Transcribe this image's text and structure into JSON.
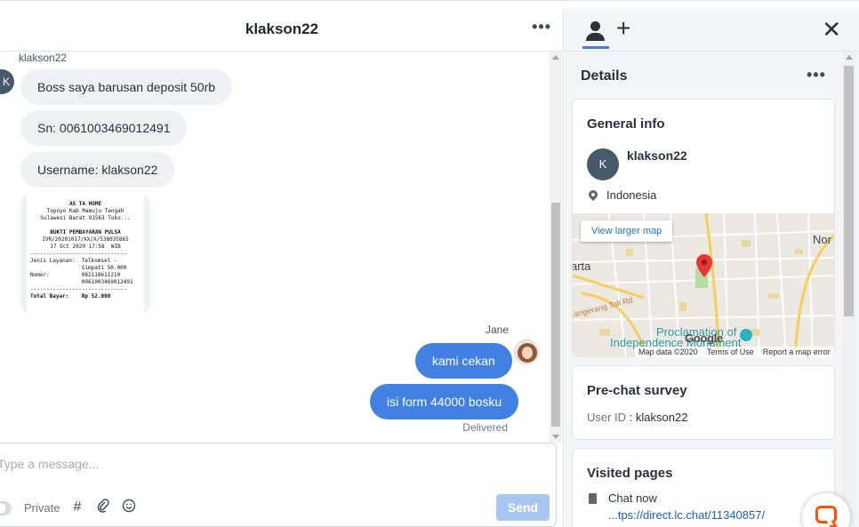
{
  "chat": {
    "title": "klakson22",
    "more_icon": "more-horizontal-icon",
    "sender_name": "klakson22",
    "sender_initial": "K",
    "messages_in": [
      "Boss saya barusan deposit 50rb",
      "Sn: 0061003469012491",
      "Username: klakson22"
    ],
    "receipt": {
      "shop": "AS TA HOME",
      "address1": "Topoyo Kab Mamuju Tengah",
      "address2": "Sulawesi Barat 91563 Toko...",
      "doc_title": "BUKTI PEMBAYARAN PULSA",
      "ref": "IVR/20201017/XX/X/538035865",
      "datetime": "17 Oct 2020 17:58  WIB",
      "service_label": "Jenis Layanan:",
      "service_value": "Telkomsel -",
      "service_value2": "Simpati 50.000",
      "number_label": "Nomor:",
      "number_value": "082118611210",
      "number_value2": "0061003469012491",
      "total_label": "Total Bayar:",
      "total_value": "Rp 52.000"
    },
    "agent_name": "Jane",
    "messages_out": [
      "kami cekan",
      "isi form 44000 bosku"
    ],
    "status": "Delivered"
  },
  "composer": {
    "placeholder": "Type a message...",
    "private_label": "Private",
    "hash_icon": "#",
    "attach_icon": "paperclip-icon",
    "emoji_icon": "emoji-icon",
    "send_label": "Send"
  },
  "details": {
    "heading": "Details",
    "general": {
      "title": "General info",
      "initial": "K",
      "name": "klakson22",
      "country": "Indonesia",
      "map_button": "View larger map",
      "map_places": {
        "left": "arta",
        "right": "Nor",
        "road": "Tangerang Toll Rd",
        "poi1": "Proclamation of",
        "poi2": "Independence Monument"
      },
      "map_google": "Google",
      "map_data": "Map data ©2020",
      "map_terms": "Terms of Use",
      "map_report": "Report a map error"
    },
    "survey": {
      "title": "Pre-chat survey",
      "user_id_label": "User ID",
      "user_id_value": "klakson22"
    },
    "visited": {
      "title": "Visited pages",
      "page_title": "Chat now",
      "page_url": "...tps://direct.lc.chat/11340857/"
    }
  },
  "colors": {
    "accent": "#4281e2",
    "send_disabled": "#a9c6f1",
    "livechat_orange": "#ff5100",
    "map_pin": "#e53935"
  }
}
